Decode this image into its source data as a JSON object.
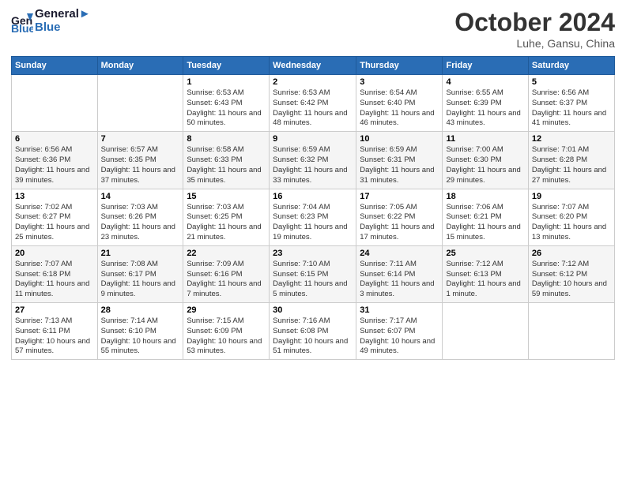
{
  "header": {
    "logo_line1": "General",
    "logo_line2": "Blue",
    "title": "October 2024",
    "subtitle": "Luhe, Gansu, China"
  },
  "weekdays": [
    "Sunday",
    "Monday",
    "Tuesday",
    "Wednesday",
    "Thursday",
    "Friday",
    "Saturday"
  ],
  "weeks": [
    [
      {
        "day": "",
        "info": ""
      },
      {
        "day": "",
        "info": ""
      },
      {
        "day": "1",
        "info": "Sunrise: 6:53 AM\nSunset: 6:43 PM\nDaylight: 11 hours and 50 minutes."
      },
      {
        "day": "2",
        "info": "Sunrise: 6:53 AM\nSunset: 6:42 PM\nDaylight: 11 hours and 48 minutes."
      },
      {
        "day": "3",
        "info": "Sunrise: 6:54 AM\nSunset: 6:40 PM\nDaylight: 11 hours and 46 minutes."
      },
      {
        "day": "4",
        "info": "Sunrise: 6:55 AM\nSunset: 6:39 PM\nDaylight: 11 hours and 43 minutes."
      },
      {
        "day": "5",
        "info": "Sunrise: 6:56 AM\nSunset: 6:37 PM\nDaylight: 11 hours and 41 minutes."
      }
    ],
    [
      {
        "day": "6",
        "info": "Sunrise: 6:56 AM\nSunset: 6:36 PM\nDaylight: 11 hours and 39 minutes."
      },
      {
        "day": "7",
        "info": "Sunrise: 6:57 AM\nSunset: 6:35 PM\nDaylight: 11 hours and 37 minutes."
      },
      {
        "day": "8",
        "info": "Sunrise: 6:58 AM\nSunset: 6:33 PM\nDaylight: 11 hours and 35 minutes."
      },
      {
        "day": "9",
        "info": "Sunrise: 6:59 AM\nSunset: 6:32 PM\nDaylight: 11 hours and 33 minutes."
      },
      {
        "day": "10",
        "info": "Sunrise: 6:59 AM\nSunset: 6:31 PM\nDaylight: 11 hours and 31 minutes."
      },
      {
        "day": "11",
        "info": "Sunrise: 7:00 AM\nSunset: 6:30 PM\nDaylight: 11 hours and 29 minutes."
      },
      {
        "day": "12",
        "info": "Sunrise: 7:01 AM\nSunset: 6:28 PM\nDaylight: 11 hours and 27 minutes."
      }
    ],
    [
      {
        "day": "13",
        "info": "Sunrise: 7:02 AM\nSunset: 6:27 PM\nDaylight: 11 hours and 25 minutes."
      },
      {
        "day": "14",
        "info": "Sunrise: 7:03 AM\nSunset: 6:26 PM\nDaylight: 11 hours and 23 minutes."
      },
      {
        "day": "15",
        "info": "Sunrise: 7:03 AM\nSunset: 6:25 PM\nDaylight: 11 hours and 21 minutes."
      },
      {
        "day": "16",
        "info": "Sunrise: 7:04 AM\nSunset: 6:23 PM\nDaylight: 11 hours and 19 minutes."
      },
      {
        "day": "17",
        "info": "Sunrise: 7:05 AM\nSunset: 6:22 PM\nDaylight: 11 hours and 17 minutes."
      },
      {
        "day": "18",
        "info": "Sunrise: 7:06 AM\nSunset: 6:21 PM\nDaylight: 11 hours and 15 minutes."
      },
      {
        "day": "19",
        "info": "Sunrise: 7:07 AM\nSunset: 6:20 PM\nDaylight: 11 hours and 13 minutes."
      }
    ],
    [
      {
        "day": "20",
        "info": "Sunrise: 7:07 AM\nSunset: 6:18 PM\nDaylight: 11 hours and 11 minutes."
      },
      {
        "day": "21",
        "info": "Sunrise: 7:08 AM\nSunset: 6:17 PM\nDaylight: 11 hours and 9 minutes."
      },
      {
        "day": "22",
        "info": "Sunrise: 7:09 AM\nSunset: 6:16 PM\nDaylight: 11 hours and 7 minutes."
      },
      {
        "day": "23",
        "info": "Sunrise: 7:10 AM\nSunset: 6:15 PM\nDaylight: 11 hours and 5 minutes."
      },
      {
        "day": "24",
        "info": "Sunrise: 7:11 AM\nSunset: 6:14 PM\nDaylight: 11 hours and 3 minutes."
      },
      {
        "day": "25",
        "info": "Sunrise: 7:12 AM\nSunset: 6:13 PM\nDaylight: 11 hours and 1 minute."
      },
      {
        "day": "26",
        "info": "Sunrise: 7:12 AM\nSunset: 6:12 PM\nDaylight: 10 hours and 59 minutes."
      }
    ],
    [
      {
        "day": "27",
        "info": "Sunrise: 7:13 AM\nSunset: 6:11 PM\nDaylight: 10 hours and 57 minutes."
      },
      {
        "day": "28",
        "info": "Sunrise: 7:14 AM\nSunset: 6:10 PM\nDaylight: 10 hours and 55 minutes."
      },
      {
        "day": "29",
        "info": "Sunrise: 7:15 AM\nSunset: 6:09 PM\nDaylight: 10 hours and 53 minutes."
      },
      {
        "day": "30",
        "info": "Sunrise: 7:16 AM\nSunset: 6:08 PM\nDaylight: 10 hours and 51 minutes."
      },
      {
        "day": "31",
        "info": "Sunrise: 7:17 AM\nSunset: 6:07 PM\nDaylight: 10 hours and 49 minutes."
      },
      {
        "day": "",
        "info": ""
      },
      {
        "day": "",
        "info": ""
      }
    ]
  ]
}
